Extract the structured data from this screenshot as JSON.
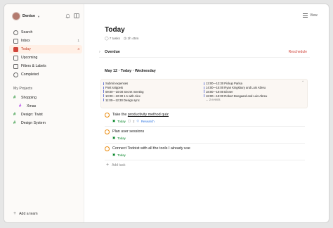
{
  "sidebar": {
    "user_name": "Denise",
    "nav": [
      {
        "label": "Search",
        "count": "",
        "icon": "search-icon"
      },
      {
        "label": "Inbox",
        "count": "1",
        "icon": "inbox-icon"
      },
      {
        "label": "Today",
        "count": "4",
        "icon": "calendar-today-icon",
        "active": true
      },
      {
        "label": "Upcoming",
        "count": "",
        "icon": "calendar-upcoming-icon"
      },
      {
        "label": "Filters & Labels",
        "count": "",
        "icon": "filters-icon"
      },
      {
        "label": "Completed",
        "count": "",
        "icon": "check-circle-icon"
      }
    ],
    "projects_title": "My Projects",
    "projects": [
      {
        "label": "Shopping",
        "color": "#299438"
      },
      {
        "label": "Xmas",
        "color": "#af38eb"
      },
      {
        "label": "Design: Twist",
        "color": "#299438"
      },
      {
        "label": "Design System",
        "color": "#299438"
      }
    ],
    "add_team": "Add a team"
  },
  "toolbar": {
    "view_label": "View"
  },
  "main": {
    "title": "Today",
    "task_count": "7 tasks",
    "duration": "2h 45m",
    "overdue_label": "Overdue",
    "reschedule_label": "Reschedule",
    "date_label": "May 12 ‧ Today ‧ Wednesday",
    "calendar_left": [
      "Submit expenses",
      "Post snippets",
      "09:00—10:00 Secret meeting",
      "10:00—10:30 1:1 with Alex",
      "11:00—12:30 Design sync"
    ],
    "calendar_right": [
      "13:00—13:30 Pickup Parisa",
      "14:00—15:00 Ryan Kingsbury and Luis Abreu",
      "18:00—19:00 Dinner",
      "18:00—19:00 Robert Boogaard and Luis Abreu"
    ],
    "calendar_more": "2 events",
    "tasks": [
      {
        "prefix": "Take the ",
        "link": "productivity method quiz",
        "date": "Today",
        "comments": "2",
        "project": "Research"
      },
      {
        "prefix": "Plan user sessions",
        "link": "",
        "date": "Today",
        "comments": "",
        "project": ""
      },
      {
        "prefix": "Connect Todoist with all the tools I already use",
        "link": "",
        "date": "Today",
        "comments": "",
        "project": ""
      }
    ],
    "add_task_label": "Add task"
  },
  "colors": {
    "accent": "#d1453b",
    "priority": "#eb8909",
    "today_green": "#058527"
  }
}
